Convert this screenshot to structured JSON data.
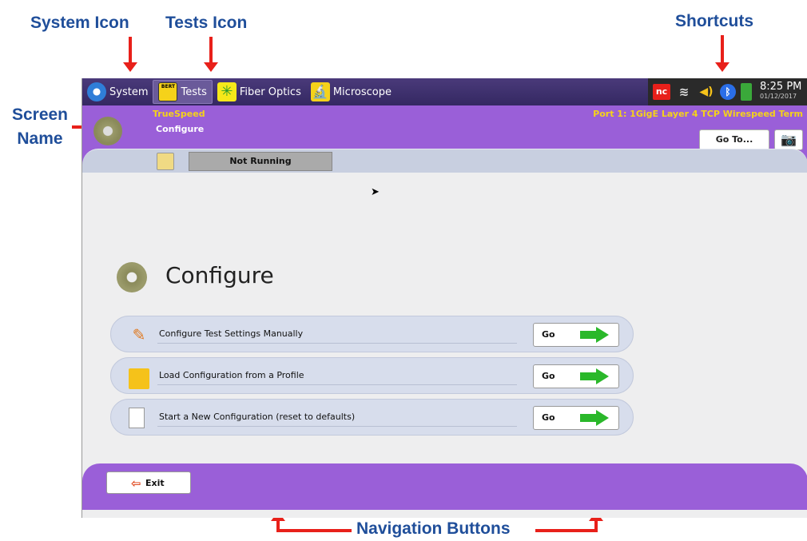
{
  "callouts": {
    "system": "System Icon",
    "tests": "Tests Icon",
    "shortcuts": "Shortcuts",
    "screen_name": "Screen Name",
    "navigation": "Navigation Buttons"
  },
  "colors": {
    "callout_text": "#1f4e9a",
    "callout_arrow": "#e8201a",
    "topbar": "#342862",
    "header": "#9a5fd8",
    "status_bar": "#c8cfe0",
    "go_arrow": "#2ab82a"
  },
  "topbar": {
    "items": [
      {
        "label": "System",
        "icon": "gear-icon"
      },
      {
        "label": "Tests",
        "icon": "bert-icon",
        "icon_text": "BERT",
        "active": true
      },
      {
        "label": "Fiber Optics",
        "icon": "fiber-icon"
      },
      {
        "label": "Microscope",
        "icon": "microscope-icon"
      }
    ],
    "shortcuts": {
      "nc": "nc",
      "icons": [
        "nc-icon",
        "wifi-icon",
        "volume-icon",
        "bluetooth-icon",
        "battery-icon"
      ],
      "time": "8:25 PM",
      "date": "01/12/2017"
    }
  },
  "header": {
    "test_name": "TrueSpeed",
    "screen_name": "Configure",
    "port": "Port 1: 1GigE Layer 4 TCP Wirespeed Term",
    "goto_label": "Go To...",
    "camera_icon": "camera-icon"
  },
  "status": {
    "text": "Not Running"
  },
  "main": {
    "title": "Configure",
    "options": [
      {
        "label": "Configure Test Settings Manually",
        "icon": "pencil-icon",
        "go_label": "Go"
      },
      {
        "label": "Load Configuration from a Profile",
        "icon": "folder-icon",
        "go_label": "Go"
      },
      {
        "label": "Start a New Configuration (reset to defaults)",
        "icon": "new-document-icon",
        "go_label": "Go"
      }
    ]
  },
  "footer": {
    "exit_label": "Exit"
  }
}
